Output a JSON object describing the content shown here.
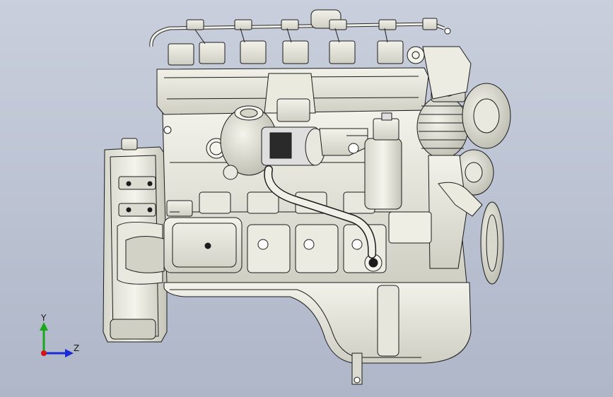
{
  "viewport": {
    "background_top": "#c9cfdc",
    "background_bottom": "#aeb6c8"
  },
  "model": {
    "body_color": "#e4e4da",
    "shade_color": "#c8c8bc",
    "edge_color": "#1c1c1c"
  },
  "triad": {
    "y_label": "Y",
    "z_label": "Z",
    "y_color": "#1aa81a",
    "z_color": "#1a2ad6",
    "x_color": "#d21414"
  }
}
